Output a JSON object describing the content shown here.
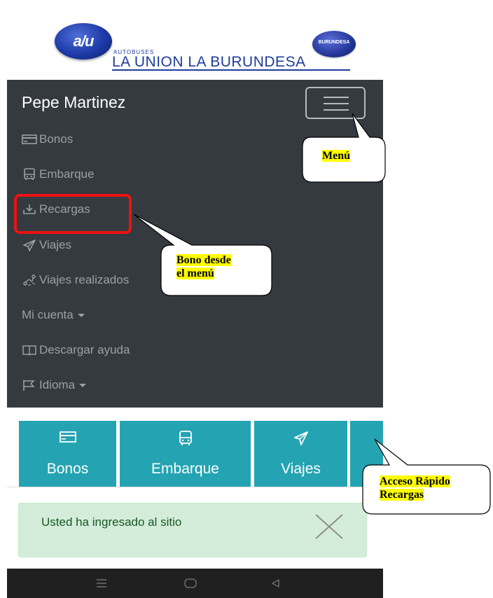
{
  "header": {
    "logo_mark": "a/u",
    "logo_small_text": "AUTOBUSES",
    "company_name": "LA UNION LA BURUNDESA",
    "logo_right_text": "BURUNDESA"
  },
  "navbar": {
    "user_name": "Pepe Martinez",
    "items": [
      {
        "label": "Bonos",
        "icon": "card-icon"
      },
      {
        "label": "Embarque",
        "icon": "bus-icon"
      },
      {
        "label": "Recargas",
        "icon": "download-icon"
      },
      {
        "label": "Viajes",
        "icon": "paper-plane-icon"
      },
      {
        "label": "Viajes realizados",
        "icon": "route-icon"
      },
      {
        "label": "Mi cuenta",
        "icon": "caret-down-icon"
      },
      {
        "label": "Descargar ayuda",
        "icon": "book-icon"
      },
      {
        "label": "Idioma",
        "icon": "flag-icon"
      }
    ]
  },
  "quick_access": {
    "tiles": [
      {
        "label": "Bonos",
        "icon": "card-icon"
      },
      {
        "label": "Embarque",
        "icon": "bus-icon"
      },
      {
        "label": "Viajes",
        "icon": "paper-plane-icon"
      }
    ]
  },
  "alert": {
    "message": "Usted ha ingresado al sitio"
  },
  "callouts": {
    "menu": "Menú",
    "bono_line1": "Bono desde",
    "bono_line2": "el menú",
    "acceso_line1": "Acceso Rápido",
    "acceso_line2": "Recargas"
  },
  "colors": {
    "navbar_bg": "#343a40",
    "tile_bg": "#24a4b2",
    "alert_bg": "#d4edda",
    "highlight": "#e11111",
    "callout_highlight": "#ffff00"
  }
}
